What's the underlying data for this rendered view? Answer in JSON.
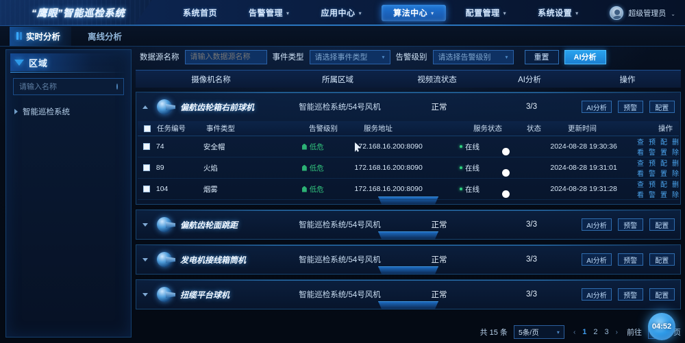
{
  "header": {
    "logo_text": "“鹰眼”智能巡检系统",
    "nav": [
      {
        "label": "系统首页",
        "has_caret": false,
        "active": false
      },
      {
        "label": "告警管理",
        "has_caret": true,
        "active": false
      },
      {
        "label": "应用中心",
        "has_caret": true,
        "active": false
      },
      {
        "label": "算法中心",
        "has_caret": true,
        "active": true
      },
      {
        "label": "配置管理",
        "has_caret": true,
        "active": false
      },
      {
        "label": "系统设置",
        "has_caret": true,
        "active": false
      }
    ],
    "user": {
      "name": "超级管理员",
      "avatar_icon": "user-avatar-icon",
      "caret": "⌄"
    }
  },
  "tabs": [
    {
      "label": "实时分析",
      "active": true
    },
    {
      "label": "离线分析",
      "active": false
    }
  ],
  "sidebar": {
    "title": "区域",
    "search_placeholder": "请输入名称",
    "search_value": "",
    "search_icon": "circle-search-icon",
    "tree": [
      {
        "label": "智能巡检系统"
      }
    ]
  },
  "filters": {
    "datasource_label": "数据源名称",
    "datasource_placeholder": "请输入数据源名称",
    "datasource_value": "",
    "event_label": "事件类型",
    "event_value": "请选择事件类型",
    "level_label": "告警级别",
    "level_value": "请选择告警级别",
    "reset_label": "重置",
    "analyze_label": "AI分析"
  },
  "table": {
    "headers": [
      "摄像机名称",
      "所属区域",
      "视频流状态",
      "AI分析",
      "操作"
    ],
    "inner_headers": [
      "任务编号",
      "事件类型",
      "告警级别",
      "服务地址",
      "服务状态",
      "状态",
      "更新时间",
      "操作"
    ],
    "row_actions": [
      "AI分析",
      "预警",
      "配置"
    ],
    "task_actions": [
      "查看",
      "预警",
      "配置",
      "删除"
    ],
    "cameras": [
      {
        "name": "偏航齿轮箱右前球机",
        "area": "智能巡检系统/54号风机",
        "video_status": "正常",
        "ai": "3/3",
        "expanded": true,
        "tasks": [
          {
            "id": "74",
            "event": "安全帽",
            "level": "低危",
            "address": "172.168.16.200:8090",
            "service_status": "在线",
            "enabled": true,
            "updated": "2024-08-28 19:30:36"
          },
          {
            "id": "89",
            "event": "火焰",
            "level": "低危",
            "address": "172.168.16.200:8090",
            "service_status": "在线",
            "enabled": true,
            "updated": "2024-08-28 19:31:01"
          },
          {
            "id": "104",
            "event": "烟雾",
            "level": "低危",
            "address": "172.168.16.200:8090",
            "service_status": "在线",
            "enabled": true,
            "updated": "2024-08-28 19:31:28"
          }
        ]
      },
      {
        "name": "偏航齿轮面跳距",
        "area": "智能巡检系统/54号风机",
        "video_status": "正常",
        "ai": "3/3",
        "expanded": false,
        "tasks": []
      },
      {
        "name": "发电机接线箱筒机",
        "area": "智能巡检系统/54号风机",
        "video_status": "正常",
        "ai": "3/3",
        "expanded": false,
        "tasks": []
      },
      {
        "name": "扭缆平台球机",
        "area": "智能巡检系统/54号风机",
        "video_status": "正常",
        "ai": "3/3",
        "expanded": false,
        "tasks": []
      }
    ]
  },
  "footer": {
    "total_label": "共 15 条",
    "page_size": "5条/页",
    "pages": [
      "1",
      "2",
      "3"
    ],
    "current_page": "1",
    "prev_arrow": "‹",
    "next_arrow": "›",
    "goto_prefix": "前往",
    "goto_value": "",
    "goto_suffix": "页",
    "clock_badge": "04:52"
  },
  "colors": {
    "accent": "#1f8ee0",
    "accent_bright": "#3f9ef0",
    "ok_green": "#31c27c",
    "panel_border": "#17446f",
    "bg": "#050b18"
  }
}
